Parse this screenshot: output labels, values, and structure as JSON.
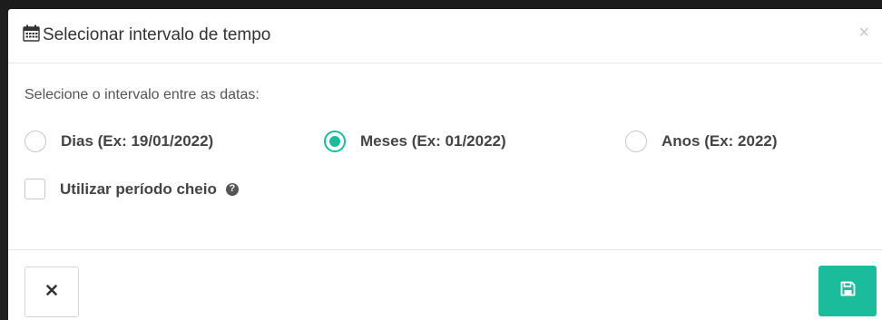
{
  "modal": {
    "title": "Selecionar intervalo de tempo",
    "title_icon": "calendar-icon",
    "close_symbol": "×"
  },
  "body": {
    "prompt": "Selecione o intervalo entre as datas:",
    "interval_options": [
      {
        "label": "Dias (Ex: 19/01/2022)",
        "checked": false
      },
      {
        "label": "Meses (Ex: 01/2022)",
        "checked": true
      },
      {
        "label": "Anos (Ex: 2022)",
        "checked": false
      }
    ],
    "full_period": {
      "label": "Utilizar período cheio",
      "checked": false,
      "help_symbol": "?"
    }
  },
  "footer": {
    "cancel_icon": "close-icon",
    "save_icon": "floppy-disk-icon"
  },
  "colors": {
    "accent": "#1abc9c",
    "backdrop": "#1f1f1f"
  }
}
